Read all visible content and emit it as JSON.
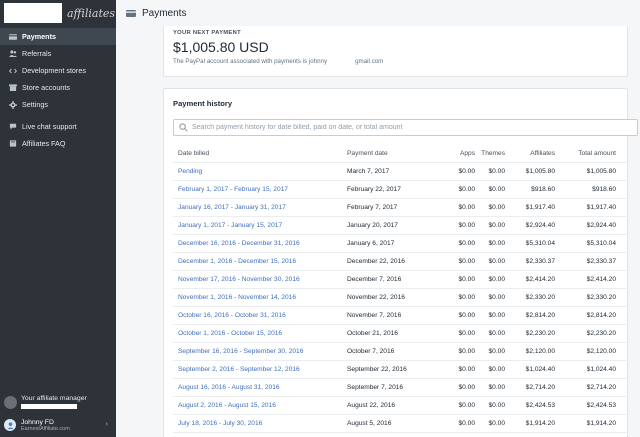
{
  "brand": {
    "text": "affiliates"
  },
  "sidebar": {
    "items": [
      {
        "label": "Payments",
        "icon": "payments-icon",
        "active": true
      },
      {
        "label": "Referrals",
        "icon": "referrals-icon"
      },
      {
        "label": "Development stores",
        "icon": "code-icon"
      },
      {
        "label": "Store accounts",
        "icon": "store-icon"
      },
      {
        "label": "Settings",
        "icon": "gear-icon"
      },
      {
        "label": "Live chat support",
        "icon": "chat-icon"
      },
      {
        "label": "Affiliates FAQ",
        "icon": "book-icon"
      }
    ],
    "manager_label": "Your affiliate manager",
    "user": {
      "name": "Johnny FD",
      "site": "EarnestAffiliate.com"
    }
  },
  "topbar": {
    "title": "Payments"
  },
  "next_payment": {
    "label": "YOUR NEXT PAYMENT",
    "amount": "$1,005.80 USD",
    "note": "The PayPal account associated with payments is johnny",
    "email_domain": "gmail.com"
  },
  "history": {
    "title": "Payment history",
    "search_placeholder": "Search payment history for date billed, paid on date, or total amount",
    "headers": [
      "Date billed",
      "Payment date",
      "Apps",
      "Themes",
      "Affiliates",
      "Total amount"
    ],
    "rows": [
      {
        "billed": "Pending",
        "paid": "March 7, 2017",
        "apps": "$0.00",
        "themes": "$0.00",
        "affiliates": "$1,005.80",
        "total": "$1,005.80"
      },
      {
        "billed": "February 1, 2017 - February 15, 2017",
        "paid": "February 22, 2017",
        "apps": "$0.00",
        "themes": "$0.00",
        "affiliates": "$918.60",
        "total": "$918.60"
      },
      {
        "billed": "January 16, 2017 - January 31, 2017",
        "paid": "February 7, 2017",
        "apps": "$0.00",
        "themes": "$0.00",
        "affiliates": "$1,917.40",
        "total": "$1,917.40"
      },
      {
        "billed": "January 1, 2017 - January 15, 2017",
        "paid": "January 20, 2017",
        "apps": "$0.00",
        "themes": "$0.00",
        "affiliates": "$2,924.40",
        "total": "$2,924.40"
      },
      {
        "billed": "December 16, 2016 - December 31, 2016",
        "paid": "January 6, 2017",
        "apps": "$0.00",
        "themes": "$0.00",
        "affiliates": "$5,310.04",
        "total": "$5,310.04"
      },
      {
        "billed": "December 1, 2016 - December 15, 2016",
        "paid": "December 22, 2016",
        "apps": "$0.00",
        "themes": "$0.00",
        "affiliates": "$2,330.37",
        "total": "$2,330.37"
      },
      {
        "billed": "November 17, 2016 - November 30, 2016",
        "paid": "December 7, 2016",
        "apps": "$0.00",
        "themes": "$0.00",
        "affiliates": "$2,414.20",
        "total": "$2,414.20"
      },
      {
        "billed": "November 1, 2016 - November 14, 2016",
        "paid": "November 22, 2016",
        "apps": "$0.00",
        "themes": "$0.00",
        "affiliates": "$2,330.20",
        "total": "$2,330.20"
      },
      {
        "billed": "October 16, 2016 - October 31, 2016",
        "paid": "November 7, 2016",
        "apps": "$0.00",
        "themes": "$0.00",
        "affiliates": "$2,814.20",
        "total": "$2,814.20"
      },
      {
        "billed": "October 1, 2016 - October 15, 2016",
        "paid": "October 21, 2016",
        "apps": "$0.00",
        "themes": "$0.00",
        "affiliates": "$2,230.20",
        "total": "$2,230.20"
      },
      {
        "billed": "September 16, 2016 - September 30, 2016",
        "paid": "October 7, 2016",
        "apps": "$0.00",
        "themes": "$0.00",
        "affiliates": "$2,120.00",
        "total": "$2,120.00"
      },
      {
        "billed": "September 2, 2016 - September 12, 2016",
        "paid": "September 22, 2016",
        "apps": "$0.00",
        "themes": "$0.00",
        "affiliates": "$1,024.40",
        "total": "$1,024.40"
      },
      {
        "billed": "August 16, 2016 - August 31, 2016",
        "paid": "September 7, 2016",
        "apps": "$0.00",
        "themes": "$0.00",
        "affiliates": "$2,714.20",
        "total": "$2,714.20"
      },
      {
        "billed": "August 2, 2016 - August 15, 2016",
        "paid": "August 22, 2016",
        "apps": "$0.00",
        "themes": "$0.00",
        "affiliates": "$2,424.53",
        "total": "$2,424.53"
      },
      {
        "billed": "July 18, 2016 - July 30, 2016",
        "paid": "August 5, 2016",
        "apps": "$0.00",
        "themes": "$0.00",
        "affiliates": "$1,914.20",
        "total": "$1,914.20"
      }
    ]
  }
}
